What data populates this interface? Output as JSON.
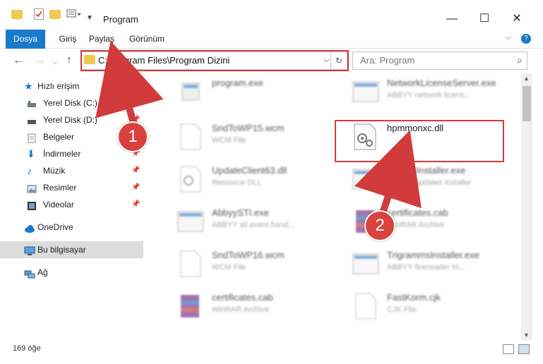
{
  "window": {
    "title": "Program"
  },
  "ribbon": {
    "tabs": [
      "Dosya",
      "Giriş",
      "Paylaş",
      "Görünüm"
    ]
  },
  "address": {
    "path": "C:\\Program Files\\Program Dizini"
  },
  "search": {
    "placeholder": "Ara: Program"
  },
  "sidebar": {
    "quick_access": "Hızlı erişim",
    "items": [
      "Yerel Disk (C:)",
      "Yerel Disk (D:)",
      "Belgeler",
      "İndirmeler",
      "Müzik",
      "Resimler",
      "Videolar"
    ],
    "onedrive": "OneDrive",
    "this_pc": "Bu bilgisayar",
    "network": "Ağ"
  },
  "files": [
    {
      "name": "program.exe",
      "type": ""
    },
    {
      "name": "NetworkLicenseServer.exe",
      "type": "ABBYY network licens..."
    },
    {
      "name": "SndToWP15.wcm",
      "type": "WCM File"
    },
    {
      "name": "hpmmonxc.dll",
      "type": ""
    },
    {
      "name": "UpdateClient63.dll",
      "type": "Resource DLL"
    },
    {
      "name": "UpdateInstaller.exe",
      "type": "ABBYY updates installer"
    },
    {
      "name": "AbbyySTI.exe",
      "type": "ABBYY sti event hand..."
    },
    {
      "name": "certificates.cab",
      "type": "WinRAR Archive"
    },
    {
      "name": "SndToWP16.wcm",
      "type": "WCM File"
    },
    {
      "name": "TrigrammsInstaller.exe",
      "type": "ABBYY finereader tri..."
    },
    {
      "name": "certificates.cab",
      "type": "WinRAR Archive"
    },
    {
      "name": "FastKorm.cjk",
      "type": "CJK File"
    }
  ],
  "status": {
    "count": "169 öğe"
  },
  "annotations": {
    "step1": "1",
    "step2": "2",
    "color": "#d23b3b"
  },
  "colors": {
    "accent": "#1979ca",
    "folder": "#f0c850",
    "highlight": "#d23b3b"
  }
}
